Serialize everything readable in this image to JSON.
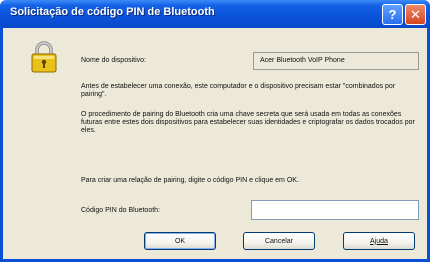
{
  "window": {
    "title": "Solicitação de código PIN de Bluetooth"
  },
  "titlebar_buttons": {
    "help": "?",
    "close": "✕"
  },
  "device": {
    "label": "Nome do dispositivo:",
    "value": "Acer Bluetooth VoIP Phone"
  },
  "paragraphs": {
    "p1": "Antes de estabelecer uma conexão, este computador e o dispositivo precisam estar \"combinados por pairing\".",
    "p2": "O procedimento de pairing do Bluetooth cria uma chave secreta que será usada em todas as conexões futuras entre estes dois dispositivos para estabelecer suas identidades e criptografar os dados trocados por eles.",
    "p3": "Para criar uma relação de pairing, digite o código PIN e clique em OK."
  },
  "pin": {
    "label": "Código PIN do Bluetooth:",
    "value": ""
  },
  "buttons": {
    "ok": "OK",
    "cancel": "Cancelar",
    "help": "Ajuda"
  },
  "colors": {
    "titlebar": "#0a52d9",
    "client_bg": "#ece9d8",
    "close_button": "#d3461f"
  },
  "icons": {
    "dialog": "padlock-icon",
    "help": "help-icon",
    "close": "close-icon"
  }
}
